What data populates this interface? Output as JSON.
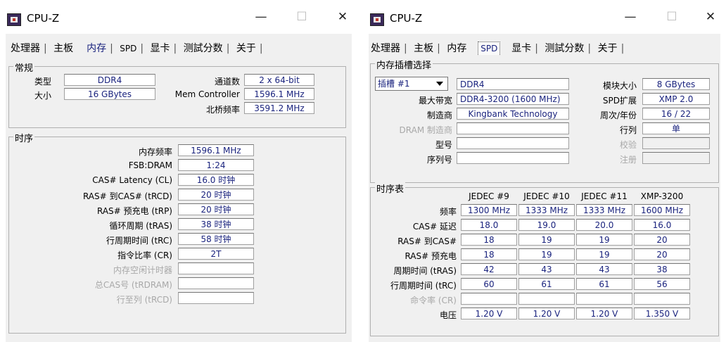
{
  "app_title": "CPU-Z",
  "controls": {
    "minimize": "—",
    "maximize": "☐",
    "close": "✕"
  },
  "tabs": [
    "处理器",
    "主板",
    "内存",
    "SPD",
    "显卡",
    "测試分数",
    "关于"
  ],
  "memory": {
    "general": {
      "title": "常规",
      "type_label": "类型",
      "type": "DDR4",
      "size_label": "大小",
      "size": "16 GBytes",
      "channels_label": "通道数",
      "channels": "2 x 64-bit",
      "mc_label": "Mem Controller",
      "mc": "1596.1 MHz",
      "nb_label": "北桥频率",
      "nb": "3591.2 MHz"
    },
    "timings": {
      "title": "时序",
      "rows": [
        {
          "label": "内存频率",
          "value": "1596.1 MHz",
          "dim": false
        },
        {
          "label": "FSB:DRAM",
          "value": "1:24",
          "dim": false
        },
        {
          "label": "CAS# Latency (CL)",
          "value": "16.0 时钟",
          "dim": false
        },
        {
          "label": "RAS# 到CAS# (tRCD)",
          "value": "20 时钟",
          "dim": false
        },
        {
          "label": "RAS# 预充电 (tRP)",
          "value": "20 时钟",
          "dim": false
        },
        {
          "label": "循环周期 (tRAS)",
          "value": "38 时钟",
          "dim": false
        },
        {
          "label": "行周期时间 (tRC)",
          "value": "58 时钟",
          "dim": false
        },
        {
          "label": "指令比率 (CR)",
          "value": "2T",
          "dim": false
        },
        {
          "label": "内存空闲计时器",
          "value": "",
          "dim": true
        },
        {
          "label": "总CAS号 (tRDRAM)",
          "value": "",
          "dim": true
        },
        {
          "label": "行至列 (tRCD)",
          "value": "",
          "dim": true
        }
      ]
    }
  },
  "spd": {
    "slot": {
      "title": "内存插槽选择",
      "selected": "插槽 #1",
      "type": "DDR4",
      "bw_label": "最大带宽",
      "bw": "DDR4-3200 (1600 MHz)",
      "mfr_label": "制造商",
      "mfr": "Kingbank Technology",
      "dram_label": "DRAM 制造商",
      "dram": "",
      "part_label": "型号",
      "part": "",
      "serial_label": "序列号",
      "serial": "",
      "modsize_label": "模块大小",
      "modsize": "8 GBytes",
      "ext_label": "SPD扩展",
      "ext": "XMP 2.0",
      "week_label": "周次/年份",
      "week": "16 / 22",
      "rank_label": "行列",
      "rank": "单",
      "correction_label": "校验",
      "correction": "",
      "registered_label": "注册",
      "registered": ""
    },
    "timings_table": {
      "title": "时序表",
      "columns": [
        "JEDEC #9",
        "JEDEC #10",
        "JEDEC #11",
        "XMP-3200"
      ],
      "rows": [
        {
          "label": "频率",
          "values": [
            "1300 MHz",
            "1333 MHz",
            "1333 MHz",
            "1600 MHz"
          ],
          "dim": false
        },
        {
          "label": "CAS# 延迟",
          "values": [
            "18.0",
            "19.0",
            "20.0",
            "16.0"
          ],
          "dim": false
        },
        {
          "label": "RAS# 到CAS#",
          "values": [
            "18",
            "19",
            "19",
            "20"
          ],
          "dim": false
        },
        {
          "label": "RAS# 预充电",
          "values": [
            "18",
            "19",
            "19",
            "20"
          ],
          "dim": false
        },
        {
          "label": "周期时间 (tRAS)",
          "values": [
            "42",
            "43",
            "43",
            "38"
          ],
          "dim": false
        },
        {
          "label": "行周期时间 (tRC)",
          "values": [
            "60",
            "61",
            "61",
            "56"
          ],
          "dim": false
        },
        {
          "label": "命令率 (CR)",
          "values": [
            "",
            "",
            "",
            ""
          ],
          "dim": true
        },
        {
          "label": "电压",
          "values": [
            "1.20 V",
            "1.20 V",
            "1.20 V",
            "1.350 V"
          ],
          "dim": false
        }
      ]
    }
  }
}
